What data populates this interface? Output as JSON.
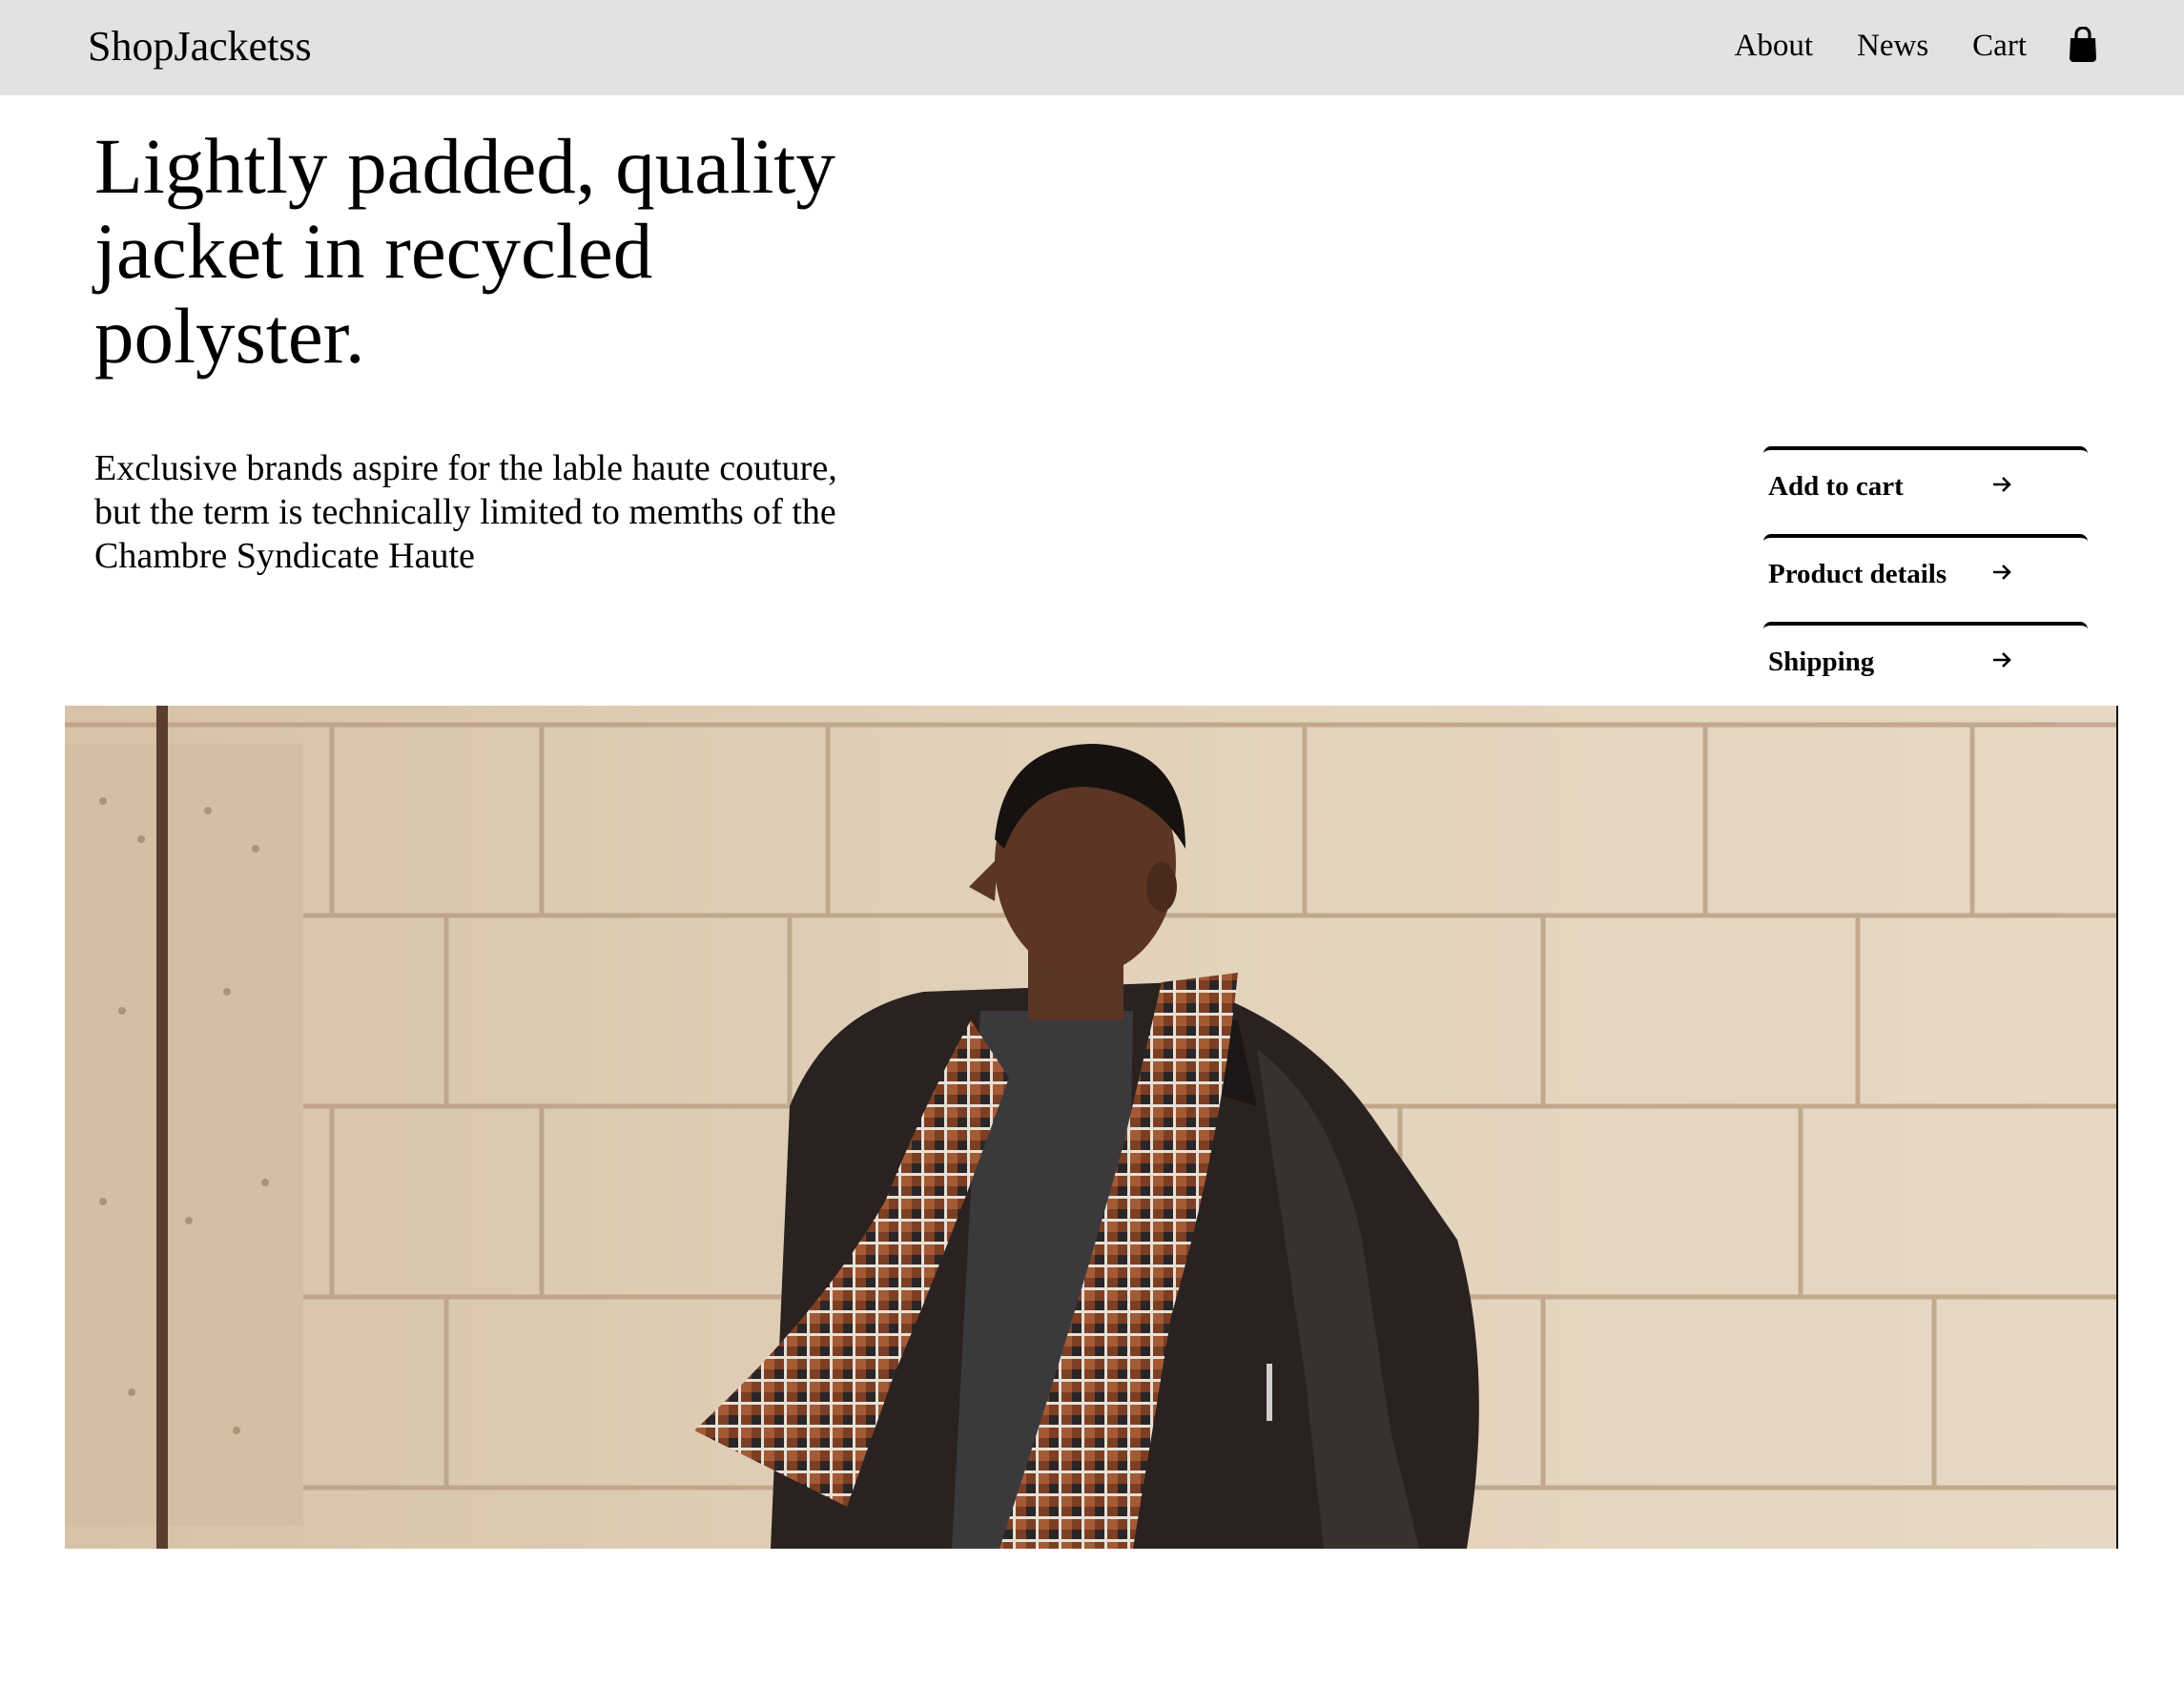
{
  "brand": "ShopJacketss",
  "nav": {
    "links": [
      "About",
      "News",
      "Cart"
    ],
    "cart_icon": "shopping-bag-icon"
  },
  "headline": "Lightly padded, quality jacket in recycled polyster.",
  "description": "Exclusive brands aspire for the lable haute couture, but the term is technically limited to memths of the Chambre Syndicate Haute",
  "actions": [
    {
      "label": "Add to cart",
      "icon": "arrow-right-icon"
    },
    {
      "label": "Product details",
      "icon": "arrow-right-icon"
    },
    {
      "label": "Shipping",
      "icon": "arrow-right-icon"
    }
  ],
  "hero": {
    "subject": "model-photo",
    "colors": {
      "wall": "#dccab2",
      "jacket": "#2a2220",
      "sweater": "#3a3a3c",
      "scarf": "#8a4a2c"
    }
  },
  "colors": {
    "navbar_bg": "#e2e2e2",
    "text": "#000000",
    "page_bg": "#ffffff"
  }
}
